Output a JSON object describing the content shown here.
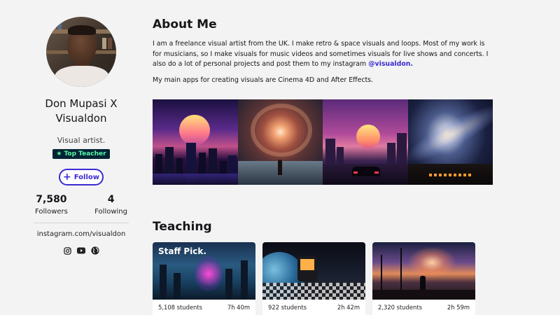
{
  "profile": {
    "name": "Don Mupasi X Visualdon",
    "role": "Visual artist.",
    "badge": "Top Teacher",
    "follow_label": "Follow",
    "followers_count": "7,580",
    "followers_label": "Followers",
    "following_count": "4",
    "following_label": "Following",
    "website": "instagram.com/visualdon",
    "social_icons": [
      "instagram-icon",
      "youtube-icon",
      "globe-icon"
    ]
  },
  "about": {
    "title": "About Me",
    "paragraph1": "I am a freelance visual artist from the UK. I make retro & space visuals and loops. Most of my work is for musicians, so I make visuals for music videos and sometimes visuals for live shows and concerts. I also do a lot of personal projects and post them to my instagram ",
    "instagram_handle": "@visualdon.",
    "paragraph2": "My main apps for creating visuals are Cinema 4D and After Effects."
  },
  "teaching": {
    "title": "Teaching",
    "cards": [
      {
        "badge": "Staff Pick.",
        "students": "5,108 students",
        "duration": "7h 40m"
      },
      {
        "students": "922 students",
        "duration": "2h 42m"
      },
      {
        "students": "2,320 students",
        "duration": "2h 59m"
      }
    ]
  },
  "colors": {
    "accent": "#3b2bd0",
    "badge_bg": "#002333",
    "badge_text": "#5bf5a7",
    "background": "#f3f3f3"
  }
}
